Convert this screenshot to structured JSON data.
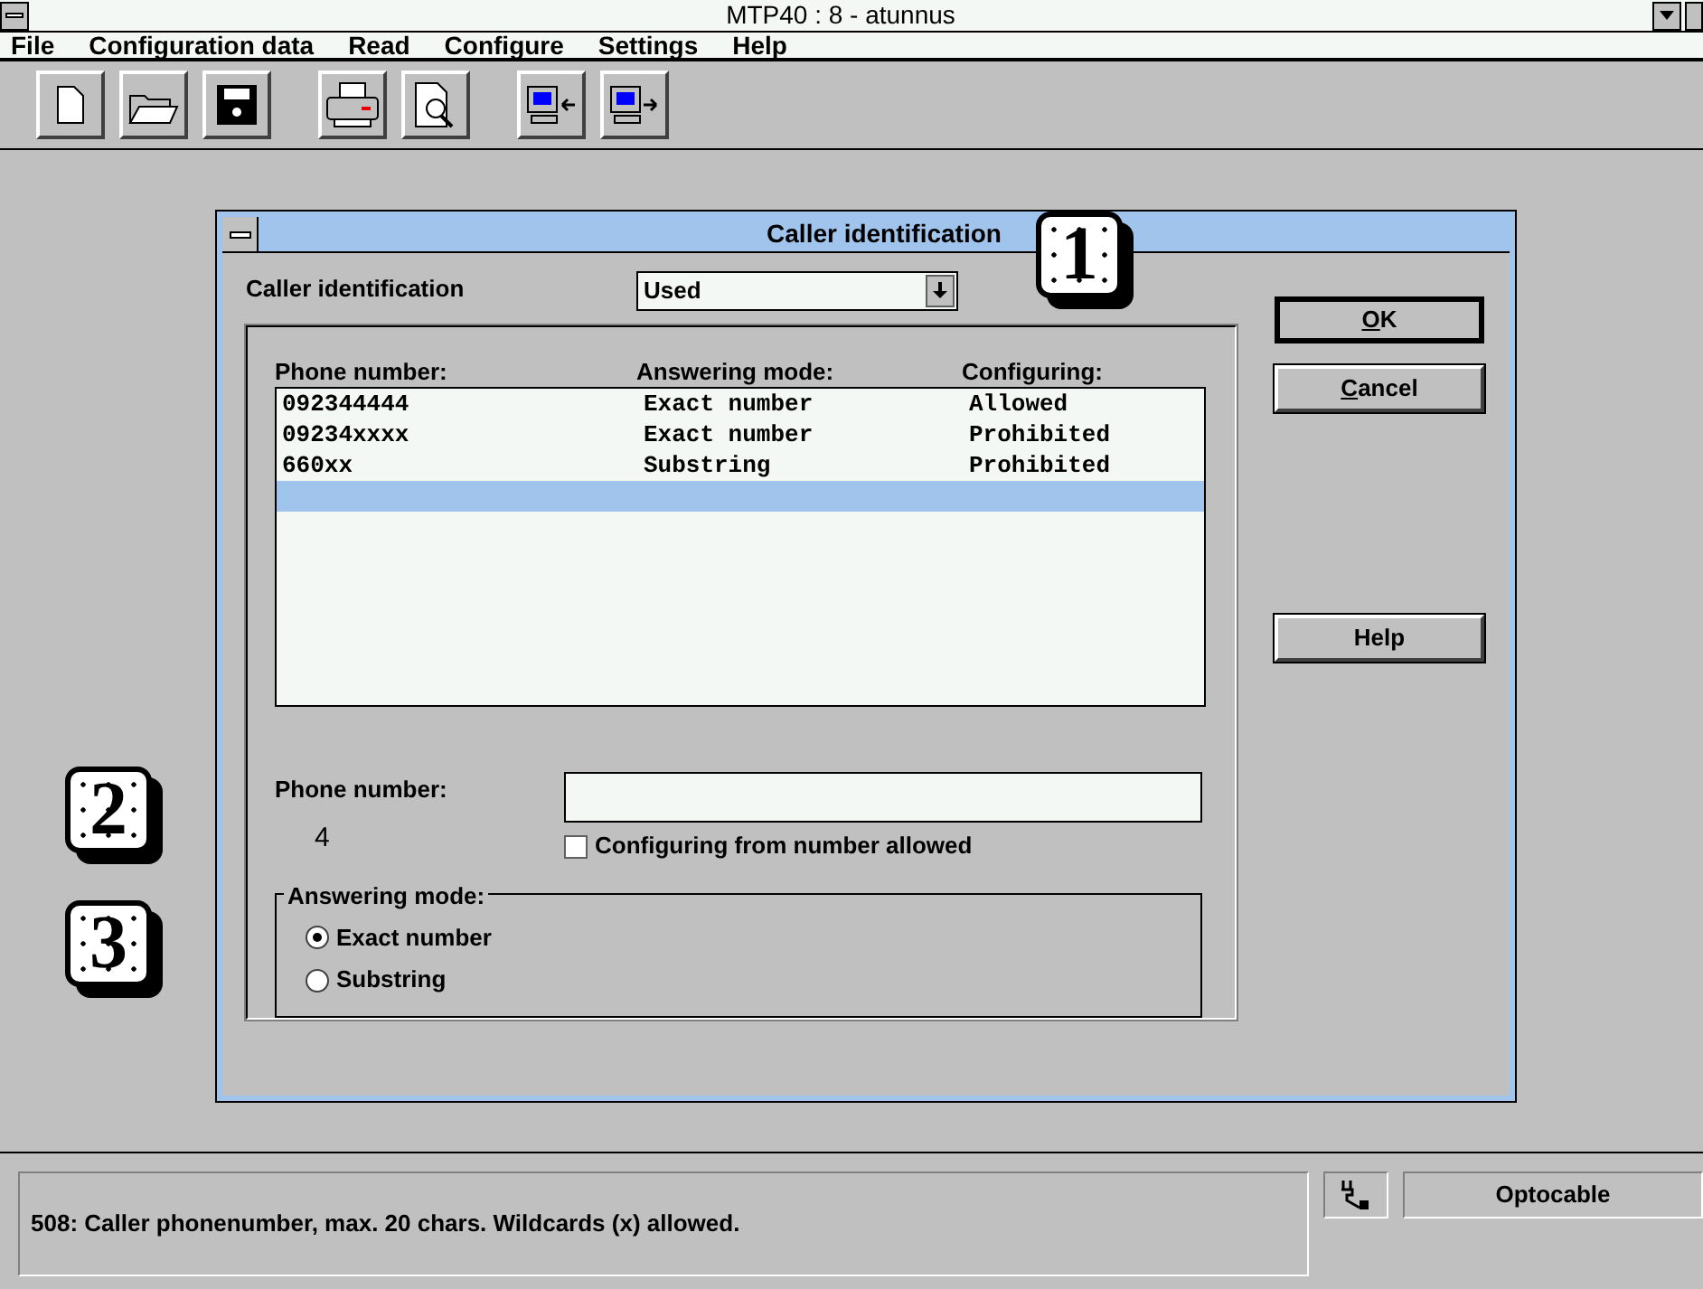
{
  "window": {
    "title": "MTP40 :  8 - atunnus"
  },
  "menu": [
    "File",
    "Configuration data",
    "Read",
    "Configure",
    "Settings",
    "Help"
  ],
  "dialog": {
    "title": "Caller identification",
    "mode_label": "Caller identification",
    "mode_value": "Used",
    "columns": [
      "Phone number:",
      "Answering mode:",
      "Configuring:"
    ],
    "rows": [
      {
        "cells": [
          "092344444",
          "Exact number",
          "Allowed"
        ],
        "selected": false
      },
      {
        "cells": [
          "09234xxxx",
          "Exact number",
          "Prohibited"
        ],
        "selected": false
      },
      {
        "cells": [
          "660xx",
          "Substring",
          "Prohibited"
        ],
        "selected": false
      },
      {
        "selected": true
      }
    ],
    "phone_label": "Phone number:",
    "count": "4",
    "checkbox": {
      "label": "Configuring from number allowed",
      "checked": false
    },
    "answering_mode": {
      "legend": "Answering mode:",
      "options": [
        {
          "label": "Exact number",
          "selected": true
        },
        {
          "label": "Substring",
          "selected": false
        }
      ]
    },
    "buttons": [
      {
        "label": "OK",
        "accel": true,
        "default": true
      },
      {
        "label": "Cancel",
        "accel": true,
        "default": false
      },
      {
        "label": "Help",
        "accel": false,
        "default": false
      }
    ]
  },
  "callouts": [
    "1",
    "2",
    "3"
  ],
  "status_bar": {
    "message": "508: Caller phonenumber, max. 20 chars. Wildcards (x) allowed.",
    "connection": "Optocable"
  }
}
